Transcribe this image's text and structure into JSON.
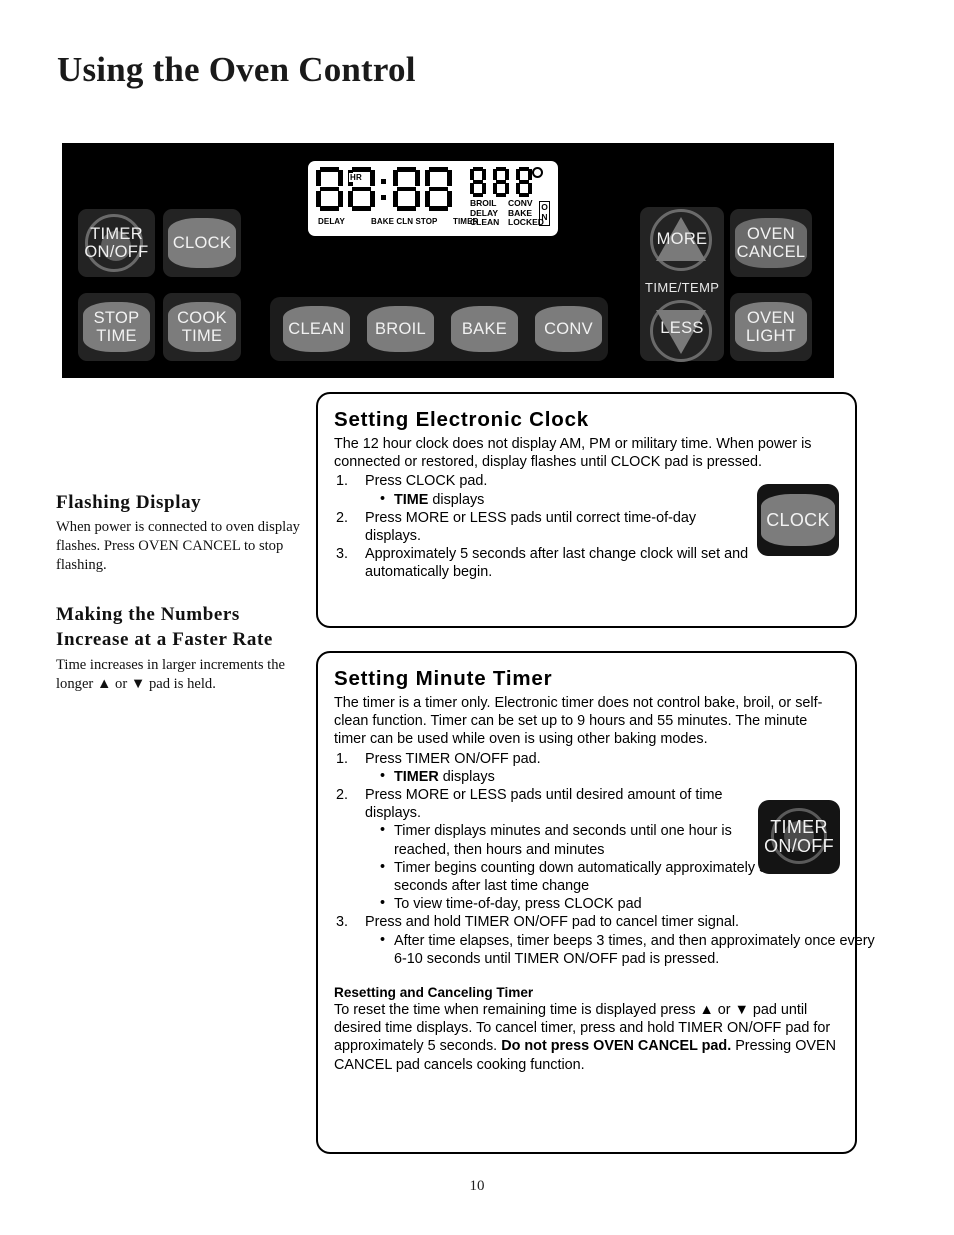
{
  "page": {
    "title": "Using the Oven Control",
    "number": "10"
  },
  "control_panel": {
    "pads": {
      "timer_on_off": [
        "TIMER",
        "ON/OFF"
      ],
      "clock": "CLOCK",
      "stop_time": [
        "STOP",
        "TIME"
      ],
      "cook_time": [
        "COOK",
        "TIME"
      ],
      "clean": "CLEAN",
      "broil": "BROIL",
      "bake": "BAKE",
      "conv": "CONV",
      "more": "MORE",
      "less": "LESS",
      "time_temp": "TIME/TEMP",
      "oven_cancel": [
        "OVEN",
        "CANCEL"
      ],
      "oven_light": [
        "OVEN",
        "LIGHT"
      ]
    },
    "display": {
      "digits": [
        "8",
        "8",
        "8",
        "8"
      ],
      "hr_label": "HR",
      "bottom_labels": [
        "DELAY",
        "BAKE CLN STOP",
        "TIMER"
      ],
      "sub_digits": [
        "8",
        "8",
        "8"
      ],
      "degree_symbol": "°",
      "indicators": [
        "BROIL",
        "CONV",
        "DELAY",
        "BAKE",
        "CLEAN",
        "LOCKED"
      ],
      "on_box": [
        "O",
        "N"
      ]
    }
  },
  "left_column": {
    "flashing_display": {
      "heading": "Flashing Display",
      "body": "When power is connected to oven display flashes. Press OVEN CANCEL to stop flashing."
    },
    "faster_rate": {
      "heading_line1": "Making the Numbers",
      "heading_line2": "Increase at a Faster Rate",
      "body_pre": "Time increases in larger increments the longer ",
      "up_arrow": "▲",
      "body_mid": " or ",
      "down_arrow": "▼",
      "body_post": " pad is held."
    }
  },
  "clock_box": {
    "title": "Setting Electronic Clock",
    "intro": "The 12 hour clock does not display AM, PM or military time. When power is connected or restored, display flashes until CLOCK pad is pressed.",
    "steps": [
      {
        "text": "Press CLOCK pad.",
        "bullets": [
          {
            "bold": "TIME",
            "rest": " displays"
          }
        ]
      },
      {
        "text": "Press  MORE or LESS pads until correct time-of-day displays.",
        "bullets": []
      },
      {
        "text": "Approximately 5 seconds after last change clock will set and automatically begin.",
        "bullets": []
      }
    ],
    "pad_label": "CLOCK"
  },
  "timer_box": {
    "title": "Setting Minute Timer",
    "intro": "The timer is a timer only. Electronic timer does not control bake, broil, or self-clean function. Timer can be set up to 9 hours and 55 minutes. The minute timer can be used while oven is using other baking modes.",
    "steps": [
      {
        "text": "Press TIMER ON/OFF pad.",
        "bullets": [
          {
            "bold": "TIMER",
            "rest": " displays"
          }
        ]
      },
      {
        "text": "Press MORE or LESS pads until desired amount of time displays.",
        "bullets": [
          {
            "bold": "",
            "rest": "Timer displays minutes and seconds until one hour is reached, then hours and minutes"
          },
          {
            "bold": "",
            "rest": "Timer begins counting down automatically approximately 5 seconds after last time change"
          },
          {
            "bold": "",
            "rest": "To view time-of-day, press CLOCK pad"
          }
        ]
      },
      {
        "text": "Press and hold TIMER ON/OFF pad to cancel timer signal.",
        "bullets": [
          {
            "bold": "",
            "rest": "After time elapses, timer beeps 3 times, and then approximately once every 6-10 seconds until TIMER ON/OFF pad is pressed."
          }
        ]
      }
    ],
    "reset_heading": "Resetting and Canceling Timer",
    "reset_p1": "To reset the time when remaining time is displayed press ",
    "reset_up": "▲",
    "reset_p2": " or ",
    "reset_dn": "▼",
    "reset_p3": " pad until desired time displays. To cancel timer, press and hold TIMER ON/OFF pad for approximately 5 seconds. ",
    "reset_bold": "Do not press OVEN CANCEL pad.",
    "reset_p4": " Pressing OVEN CANCEL pad cancels cooking function.",
    "pad_label_line1": "TIMER",
    "pad_label_line2": "ON/OFF"
  }
}
